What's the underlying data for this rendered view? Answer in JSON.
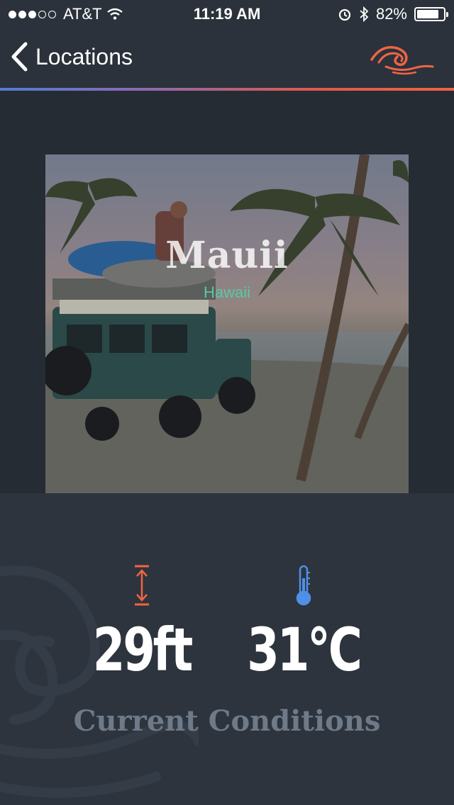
{
  "status_bar": {
    "carrier": "AT&T",
    "time": "11:19 AM",
    "battery_percent": "82%",
    "battery_level": 0.82,
    "signal_bars_filled": 3,
    "signal_bars_total": 5
  },
  "nav": {
    "back_label": "Locations",
    "logo_icon": "wave-logo-icon",
    "divider_colors": [
      "#4f7ed6",
      "#f06444"
    ]
  },
  "location": {
    "title": "Mauii",
    "subtitle": "Hawaii"
  },
  "conditions": {
    "wave_height": "29ft",
    "wave_height_icon": "wave-height-arrow-icon",
    "temperature": "31°C",
    "temperature_icon": "thermometer-icon",
    "label": "Current Conditions"
  },
  "colors": {
    "accent_orange": "#f06444",
    "accent_blue": "#4f8fe8",
    "subtitle_green": "#59c8a8",
    "label_gray": "#6e7a88"
  }
}
